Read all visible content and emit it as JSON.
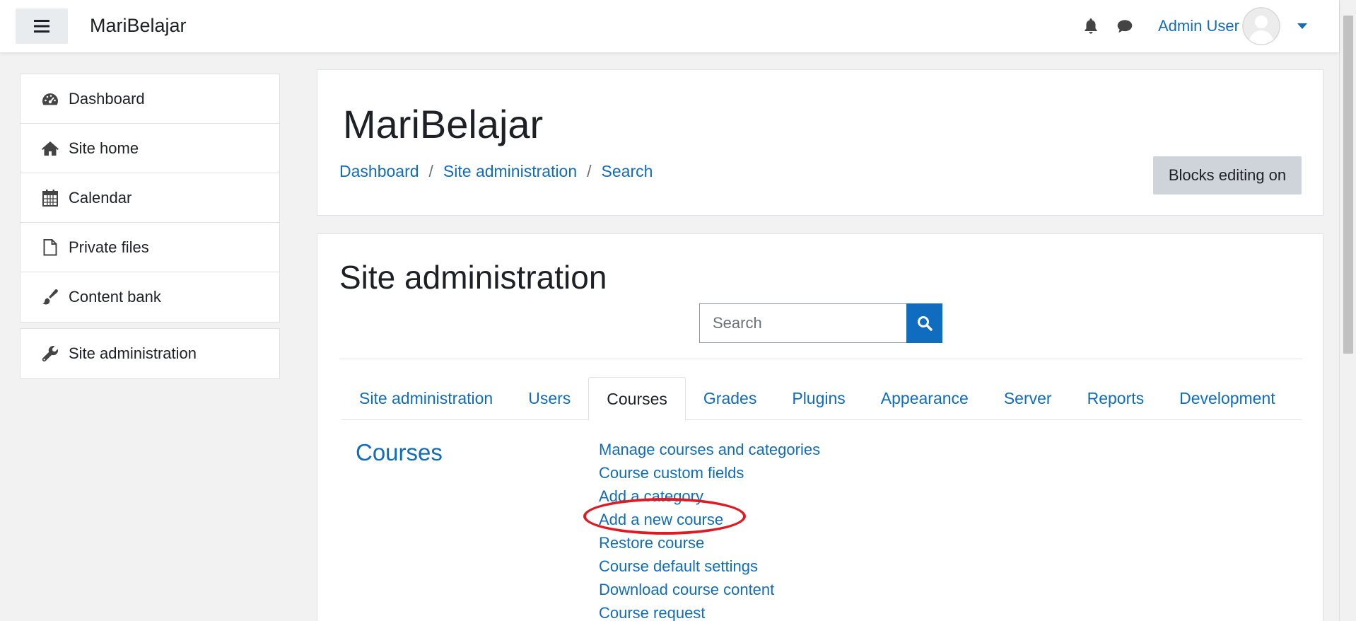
{
  "navbar": {
    "site_name": "MariBelajar",
    "user_name": "Admin User",
    "icons": [
      "menu-icon",
      "bell-icon",
      "chat-icon",
      "caret-down-icon"
    ]
  },
  "drawer": {
    "items": [
      {
        "label": "Dashboard",
        "icon": "dashboard-icon"
      },
      {
        "label": "Site home",
        "icon": "home-icon"
      },
      {
        "label": "Calendar",
        "icon": "calendar-icon"
      },
      {
        "label": "Private files",
        "icon": "file-icon"
      },
      {
        "label": "Content bank",
        "icon": "brush-icon"
      }
    ],
    "admin_item": {
      "label": "Site administration",
      "icon": "wrench-icon"
    }
  },
  "header": {
    "title": "MariBelajar",
    "breadcrumb": [
      "Dashboard",
      "Site administration",
      "Search"
    ],
    "breadcrumb_sep": "/",
    "editing_button": "Blocks editing on"
  },
  "admin": {
    "title": "Site administration",
    "search_placeholder": "Search",
    "tabs": [
      "Site administration",
      "Users",
      "Courses",
      "Grades",
      "Plugins",
      "Appearance",
      "Server",
      "Reports",
      "Development"
    ],
    "active_tab": "Courses",
    "section_title": "Courses",
    "links": [
      "Manage courses and categories",
      "Course custom fields",
      "Add a category",
      "Add a new course",
      "Restore course",
      "Course default settings",
      "Download course content",
      "Course request"
    ],
    "highlighted_link": "Add a new course"
  },
  "colors": {
    "link": "#0f6cbf",
    "highlight": "#e01a22",
    "button_gray": "#ced4da"
  }
}
